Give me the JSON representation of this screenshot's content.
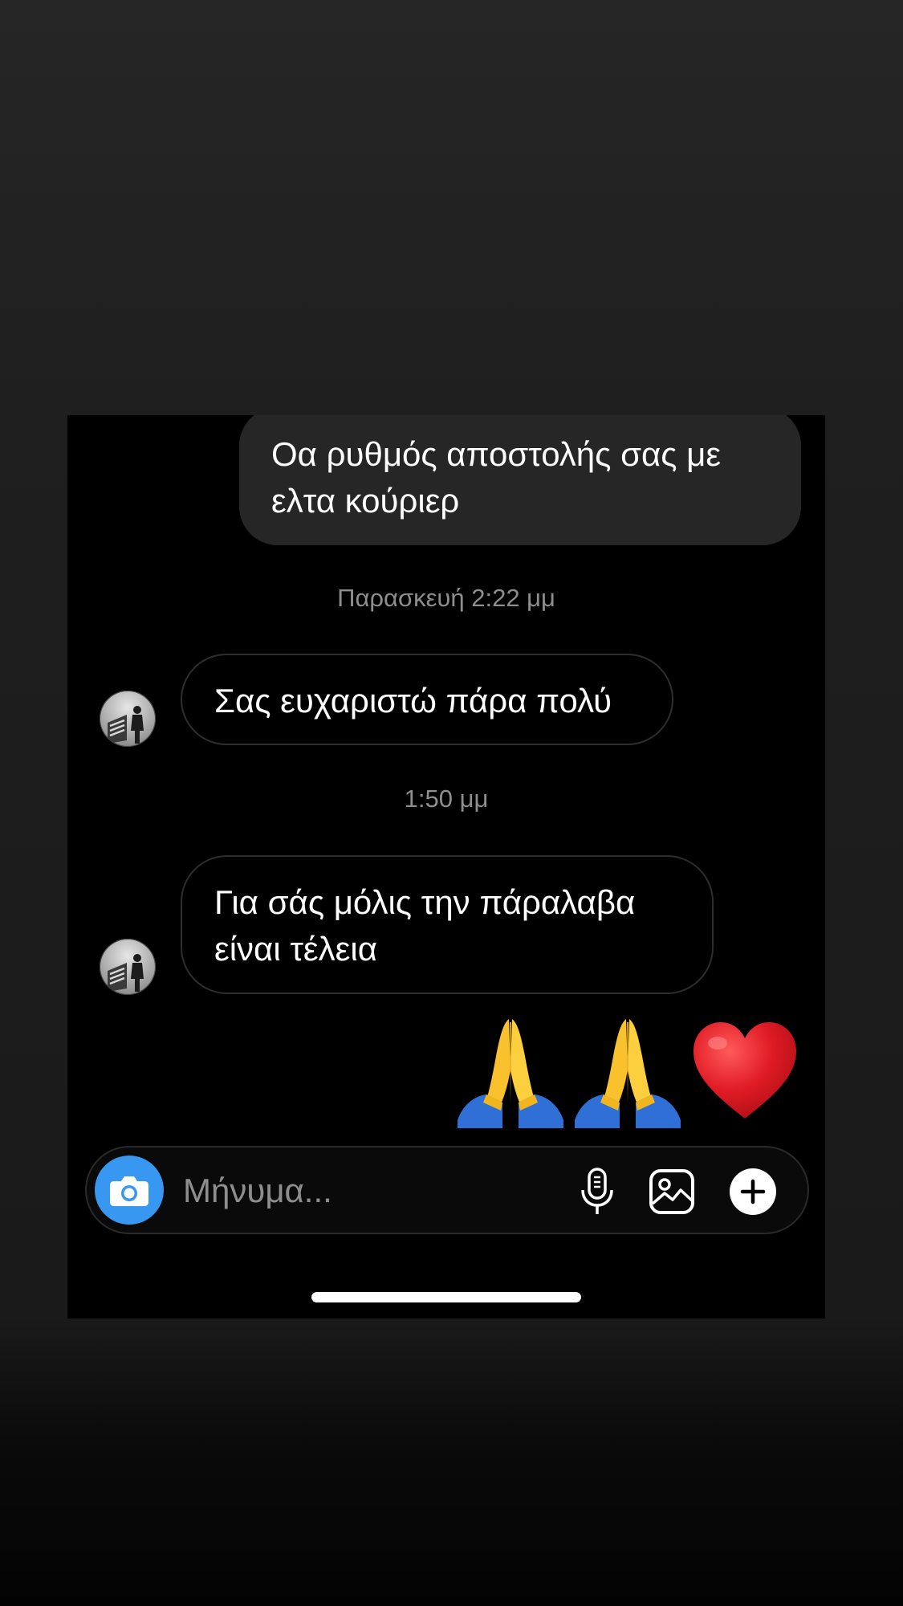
{
  "messages": {
    "outgoing_text": "Οα ρυθμός αποστολής σας με ελτα κούριερ",
    "timestamp_1": "Παρασκευή 2:22 μμ",
    "incoming_1": "Σας ευχαριστώ πάρα πολύ",
    "timestamp_2": "1:50 μμ",
    "incoming_2": "Για σάς μόλις την πάραλαβα είναι τέλεια",
    "reaction_emojis": [
      "folded-hands",
      "folded-hands",
      "red-heart"
    ]
  },
  "composer": {
    "placeholder": "Μήνυμα...",
    "icons": [
      "camera-icon",
      "microphone-icon",
      "gallery-icon",
      "plus-icon"
    ]
  },
  "colors": {
    "background": "#000000",
    "outgoing_bubble": "#262626",
    "incoming_border": "#2e2e2e",
    "camera_button": "#3897f0",
    "timestamp": "#8e8e8e"
  }
}
